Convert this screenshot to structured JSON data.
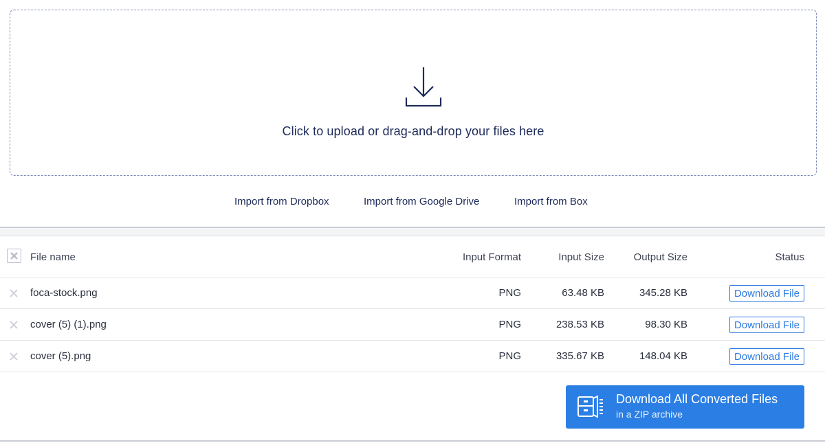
{
  "upload": {
    "prompt": "Click to upload or drag-and-drop your files here",
    "icon": "download-tray-icon"
  },
  "imports": [
    {
      "label": "Import from Dropbox"
    },
    {
      "label": "Import from Google Drive"
    },
    {
      "label": "Import from Box"
    }
  ],
  "table": {
    "headers": {
      "file_name": "File name",
      "input_format": "Input Format",
      "input_size": "Input Size",
      "output_size": "Output Size",
      "status": "Status"
    },
    "rows": [
      {
        "name": "foca-stock.png",
        "format": "PNG",
        "input_size": "63.48 KB",
        "output_size": "345.28 KB",
        "action": "Download File"
      },
      {
        "name": "cover (5) (1).png",
        "format": "PNG",
        "input_size": "238.53 KB",
        "output_size": "98.30 KB",
        "action": "Download File"
      },
      {
        "name": "cover (5).png",
        "format": "PNG",
        "input_size": "335.67 KB",
        "output_size": "148.04 KB",
        "action": "Download File"
      }
    ]
  },
  "download_all": {
    "title": "Download All Converted Files",
    "subtitle": "in a ZIP archive",
    "icon": "zip-archive-icon"
  },
  "colors": {
    "accent": "#2b7ee3",
    "text_dark": "#1d2a5a",
    "dashed_border": "#7c8ab6"
  }
}
